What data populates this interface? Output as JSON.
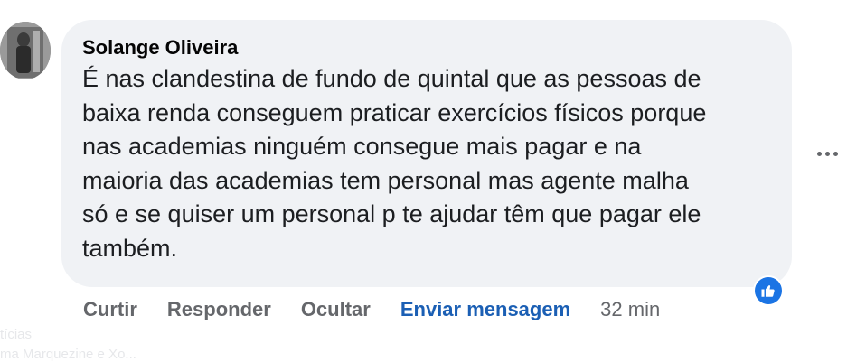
{
  "comment": {
    "author": "Solange Oliveira",
    "lines": [
      "É nas clandestina de fundo de quintal que as pessoas de",
      "baixa renda conseguem praticar exercícios físicos porque",
      "nas academias ninguém consegue mais pagar e na",
      "maioria das academias tem personal mas agente malha",
      "só e se quiser um personal p te ajudar têm que pagar ele",
      "também."
    ]
  },
  "actions": {
    "like": "Curtir",
    "reply": "Responder",
    "hide": "Ocultar",
    "message": "Enviar mensagem",
    "time": "32 min"
  },
  "reaction": {
    "icon": "thumbs-up-icon",
    "color": "#1b74e4"
  },
  "more": {
    "icon": "more-horizontal-icon"
  },
  "background": {
    "left_text": "tícias",
    "left_text2": "ma Marquezine e Xo..."
  }
}
